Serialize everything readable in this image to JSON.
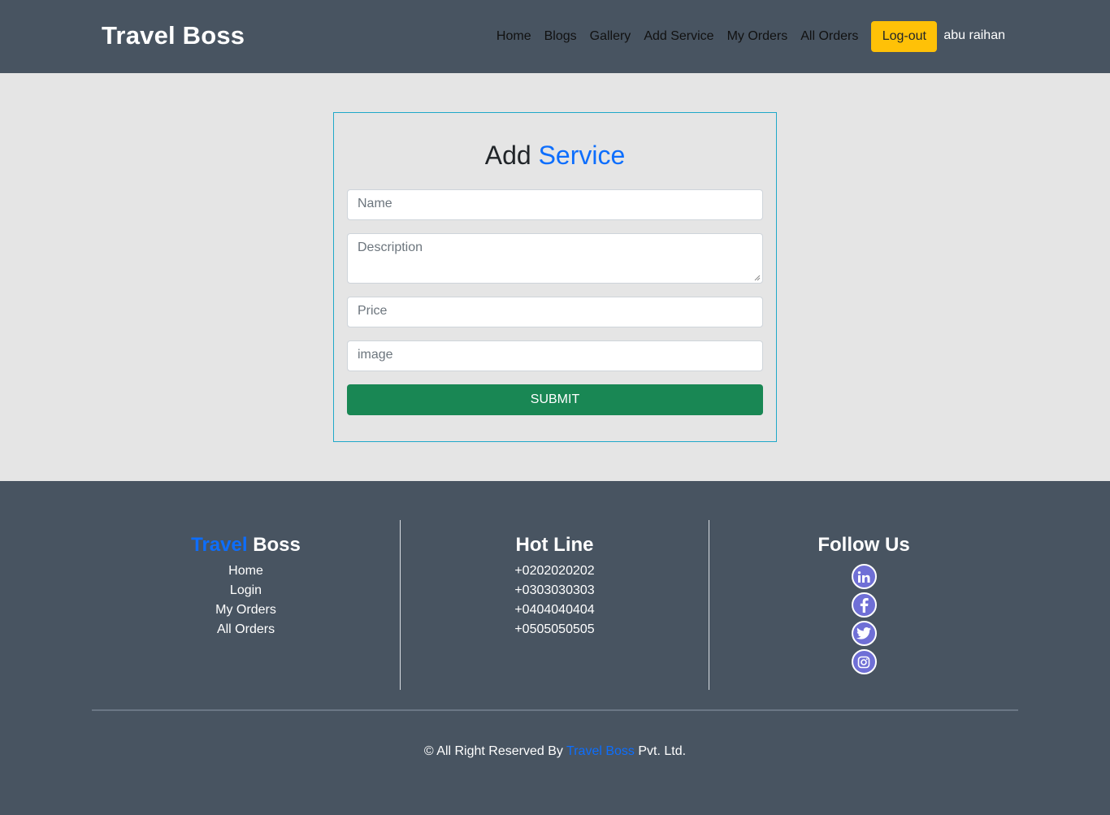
{
  "header": {
    "brand": "Travel Boss",
    "nav": [
      "Home",
      "Blogs",
      "Gallery",
      "Add Service",
      "My Orders",
      "All Orders"
    ],
    "logout_label": "Log-out",
    "user_name": "abu raihan"
  },
  "form": {
    "title_part1": "Add",
    "title_part2": "Service",
    "name_placeholder": "Name",
    "description_placeholder": "Description",
    "price_placeholder": "Price",
    "image_placeholder": "image",
    "submit_label": "SUBMIT"
  },
  "footer": {
    "brand_part1": "Travel",
    "brand_part2": "Boss",
    "links": [
      "Home",
      "Login",
      "My Orders",
      "All Orders"
    ],
    "hotline_title": "Hot Line",
    "hotlines": [
      "+0202020202",
      "+0303030303",
      "+0404040404",
      "+0505050505"
    ],
    "follow_title": "Follow Us",
    "social_icons": [
      "linkedin-icon",
      "facebook-icon",
      "twitter-icon",
      "instagram-icon"
    ],
    "copyright_prefix": "© All Right Reserved By",
    "copyright_brand": "Travel Boss",
    "copyright_suffix": "Pvt. Ltd."
  },
  "colors": {
    "header_bg": "#485461",
    "accent_blue": "#0d6efd",
    "logout_yellow": "#ffc107",
    "submit_green": "#198754",
    "social_purple": "#6f6fd6"
  }
}
